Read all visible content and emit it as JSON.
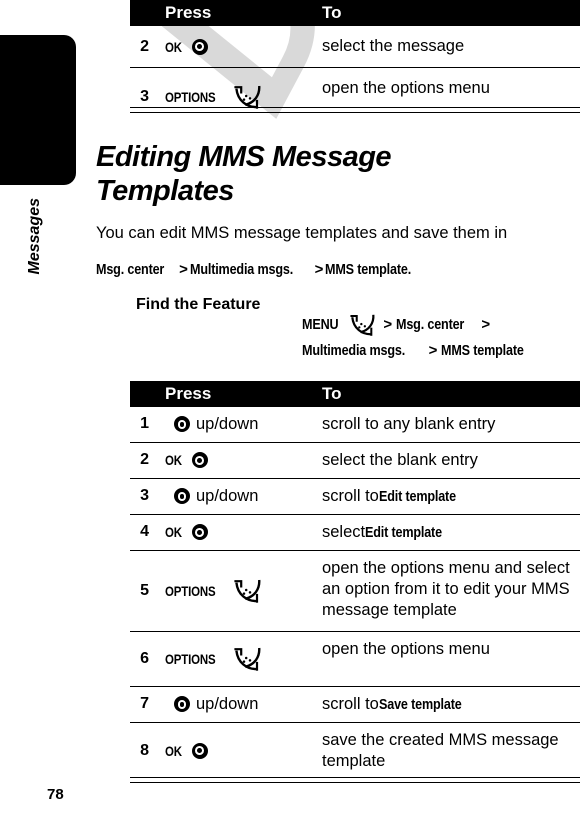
{
  "page": {
    "number": "78",
    "chapter_tab_label": "Messages",
    "watermark_text": "DRAFT"
  },
  "table_top": {
    "columns": {
      "press": "Press",
      "to": "To"
    },
    "rows": [
      {
        "num": "2",
        "key_label": "OK",
        "key_icon": "nav-select-key-icon",
        "suffix": "",
        "to": "select the message"
      },
      {
        "num": "3",
        "key_label": "OPTIONS",
        "key_icon": "soft-key-icon",
        "suffix": "",
        "to": "open the options menu"
      }
    ]
  },
  "section": {
    "heading": "Editing MMS Message Templates",
    "intro_prefix": "You can edit MMS message templates and save them in",
    "intro_path": [
      {
        "text": "Msg. center",
        "bold": true
      },
      {
        "text": ">",
        "bold": false
      },
      {
        "text": "Multimedia msgs.",
        "bold": true
      },
      {
        "text": ">",
        "bold": false
      },
      {
        "text": "MMS template.",
        "bold": true
      }
    ],
    "find_the_feature_label": "Find the Feature",
    "find_the_feature_path": {
      "key_label": "MENU",
      "key_icon": "soft-key-icon",
      "line1_items": [
        "Msg. center"
      ],
      "line2_items": [
        "Multimedia msgs.",
        "MMS template"
      ],
      "separator": ">"
    }
  },
  "table_main": {
    "columns": {
      "press": "Press",
      "to": "To"
    },
    "rows": [
      {
        "num": "1",
        "key_label": "",
        "key_icon": "nav-updown-key-icon",
        "suffix": "up/down",
        "to_prefix": "scroll to any blank entry",
        "to_bold": "",
        "to_suffix": ""
      },
      {
        "num": "2",
        "key_label": "OK",
        "key_icon": "nav-select-key-icon",
        "suffix": "",
        "to_prefix": "select the blank entry",
        "to_bold": "",
        "to_suffix": ""
      },
      {
        "num": "3",
        "key_label": "",
        "key_icon": "nav-updown-key-icon",
        "suffix": "up/down",
        "to_prefix": "scroll to ",
        "to_bold": "Edit template",
        "to_suffix": ""
      },
      {
        "num": "4",
        "key_label": "OK",
        "key_icon": "nav-select-key-icon",
        "suffix": "",
        "to_prefix": "select ",
        "to_bold": "Edit template",
        "to_suffix": ""
      },
      {
        "num": "5",
        "key_label": "OPTIONS",
        "key_icon": "soft-key-icon",
        "suffix": "",
        "to_prefix": "open the options menu and select an option from it to edit your MMS message template",
        "to_bold": "",
        "to_suffix": ""
      },
      {
        "num": "6",
        "key_label": "OPTIONS",
        "key_icon": "soft-key-icon",
        "suffix": "",
        "to_prefix": "open the options menu",
        "to_bold": "",
        "to_suffix": ""
      },
      {
        "num": "7",
        "key_label": "",
        "key_icon": "nav-updown-key-icon",
        "suffix": "up/down",
        "to_prefix": "scroll to ",
        "to_bold": "Save template",
        "to_suffix": ""
      },
      {
        "num": "8",
        "key_label": "OK",
        "key_icon": "nav-select-key-icon",
        "suffix": "",
        "to_prefix": "save the created MMS message template",
        "to_bold": "",
        "to_suffix": ""
      }
    ]
  },
  "colors": {
    "ink": "#000000",
    "paper": "#ffffff",
    "watermark": "#d9d9d9"
  }
}
